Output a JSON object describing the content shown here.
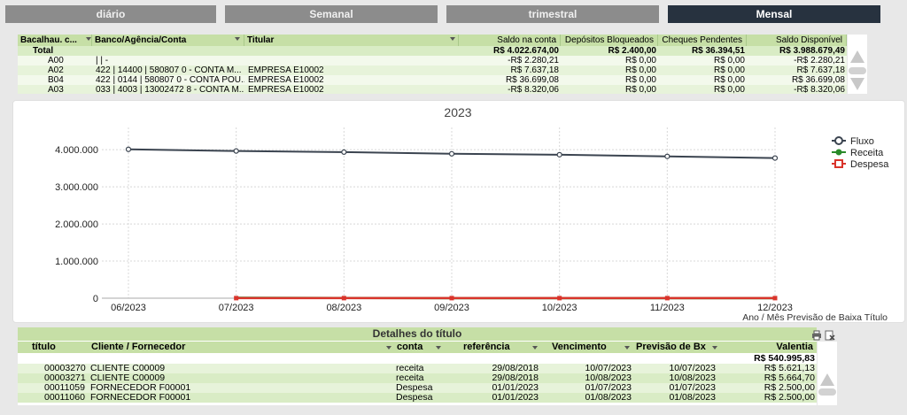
{
  "tabs": [
    {
      "label": "diário"
    },
    {
      "label": "Semanal"
    },
    {
      "label": "trimestral"
    },
    {
      "label": "Mensal",
      "active": true
    }
  ],
  "accounts_table": {
    "headers": [
      "Bacalhau. c...",
      "Banco/Agência/Conta",
      "Titular",
      "Saldo na conta",
      "Depósitos Bloqueados",
      "Cheques Pendentes",
      "Saldo Disponível"
    ],
    "total": {
      "label": "Total",
      "saldo": "R$ 4.022.674,00",
      "bloqueados": "R$ 2.400,00",
      "cheques": "R$ 36.394,51",
      "disponivel": "R$ 3.988.679,49"
    },
    "rows": [
      {
        "cod": "A00",
        "banco": "| | -",
        "titular": "",
        "saldo": "-R$ 2.280,21",
        "bloqueados": "R$ 0,00",
        "cheques": "R$ 0,00",
        "disponivel": "-R$ 2.280,21"
      },
      {
        "cod": "A02",
        "banco": "422 | 14400 | 580807 0 - CONTA M...",
        "titular": "EMPRESA E10002",
        "saldo": "R$ 7.637,18",
        "bloqueados": "R$ 0,00",
        "cheques": "R$ 0,00",
        "disponivel": "R$ 7.637,18"
      },
      {
        "cod": "B04",
        "banco": "422 | 0144 | 580807 0 - CONTA POU...",
        "titular": "EMPRESA E10002",
        "saldo": "R$ 36.699,08",
        "bloqueados": "R$ 0,00",
        "cheques": "R$ 0,00",
        "disponivel": "R$ 36.699,08"
      },
      {
        "cod": "A03",
        "banco": "033 | 4003 | 13002472 8 - CONTA M...",
        "titular": "EMPRESA E10002",
        "saldo": "-R$ 8.320,06",
        "bloqueados": "R$ 0,00",
        "cheques": "R$ 0,00",
        "disponivel": "-R$ 8.320,06"
      }
    ]
  },
  "chart_data": {
    "type": "line",
    "title": "2023",
    "xlabel": "Ano / Mês Previsão de Baixa Título",
    "ylabel": "",
    "categories": [
      "06/2023",
      "07/2023",
      "08/2023",
      "09/2023",
      "10/2023",
      "11/2023",
      "12/2023"
    ],
    "y_ticks": [
      "0",
      "1.000.000",
      "2.000.000",
      "3.000.000",
      "4.000.000"
    ],
    "ylim": [
      0,
      4600000
    ],
    "grid": true,
    "legend_position": "top-right",
    "series": [
      {
        "name": "Fluxo",
        "color": "#3b4450",
        "values": [
          4010000,
          3965000,
          3935000,
          3890000,
          3865000,
          3820000,
          3775000
        ]
      },
      {
        "name": "Receita",
        "color": "#2a8a2a",
        "values": [
          null,
          11286,
          5665,
          0,
          0,
          0,
          0
        ]
      },
      {
        "name": "Despesa",
        "color": "#d9342b",
        "values": [
          null,
          2500,
          2500,
          2500,
          2500,
          2500,
          2500
        ]
      }
    ]
  },
  "details": {
    "title": "Detalhes do título",
    "headers": [
      "título",
      "Cliente / Fornecedor",
      "conta",
      "referência",
      "Vencimento",
      "Previsão de Bx",
      "Valentia"
    ],
    "total_valor": "R$ 540.995,83",
    "rows": [
      {
        "titulo": "00003270",
        "cliente": "CLIENTE C00009",
        "conta": "receita",
        "referencia": "29/08/2018",
        "vencimento": "10/07/2023",
        "previsao": "10/07/2023",
        "valor": "R$ 5.621,13"
      },
      {
        "titulo": "00003271",
        "cliente": "CLIENTE C00009",
        "conta": "receita",
        "referencia": "29/08/2018",
        "vencimento": "10/08/2023",
        "previsao": "10/08/2023",
        "valor": "R$ 5.664,70"
      },
      {
        "titulo": "00011059",
        "cliente": "FORNECEDOR F00001",
        "conta": "Despesa",
        "referencia": "01/01/2023",
        "vencimento": "01/07/2023",
        "previsao": "01/07/2023",
        "valor": "R$ 2.500,00"
      },
      {
        "titulo": "00011060",
        "cliente": "FORNECEDOR F00001",
        "conta": "Despesa",
        "referencia": "01/01/2023",
        "vencimento": "01/08/2023",
        "previsao": "01/08/2023",
        "valor": "R$ 2.500,00"
      }
    ]
  }
}
